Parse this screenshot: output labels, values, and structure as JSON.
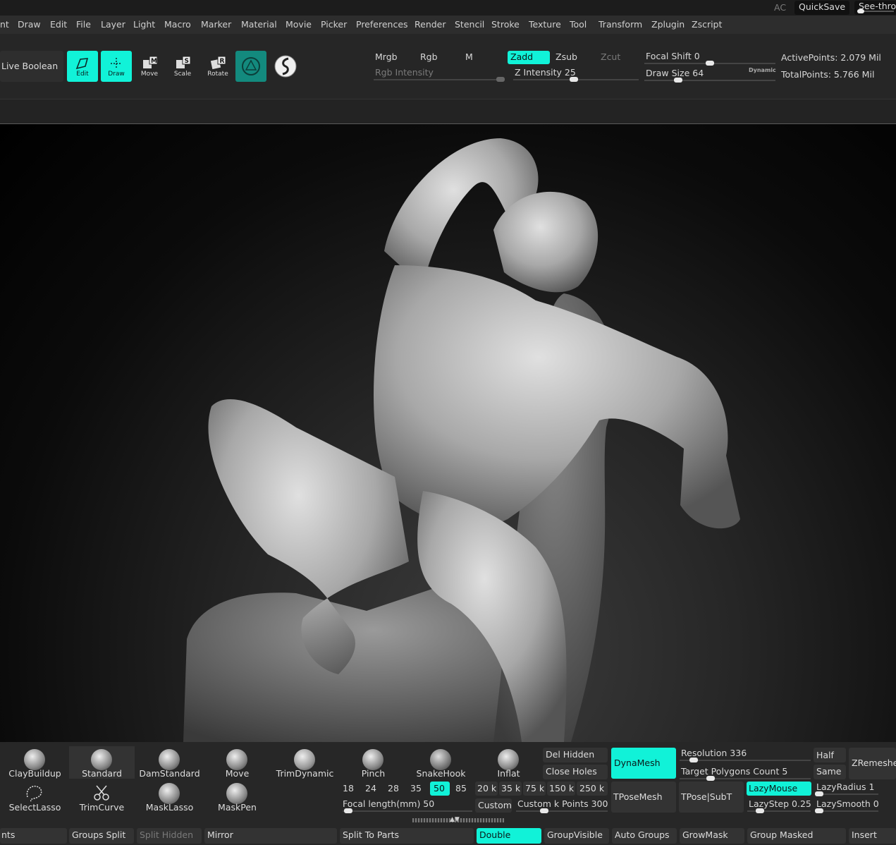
{
  "topbar": {
    "ac": "AC",
    "quicksave": "QuickSave",
    "seethrough": "See-throu"
  },
  "menu": [
    "nt",
    "Draw",
    "Edit",
    "File",
    "Layer",
    "Light",
    "Macro",
    "Marker",
    "Material",
    "Movie",
    "Picker",
    "Preferences",
    "Render",
    "Stencil",
    "Stroke",
    "Texture",
    "Tool",
    "Transform",
    "Zplugin",
    "Zscript"
  ],
  "toolbar": {
    "live_boolean": "Live Boolean",
    "tools": [
      {
        "label": "Edit",
        "active": true
      },
      {
        "label": "Draw",
        "active": true
      },
      {
        "label": "Move",
        "active": false
      },
      {
        "label": "Scale",
        "active": false
      },
      {
        "label": "Rotate",
        "active": false
      }
    ],
    "mrgb": "Mrgb",
    "rgb": "Rgb",
    "m": "M",
    "zadd": "Zadd",
    "zsub": "Zsub",
    "zcut": "Zcut",
    "rgb_intensity": "Rgb Intensity",
    "z_intensity": "Z Intensity 25",
    "z_intensity_value": 25,
    "focal_shift": "Focal Shift 0",
    "focal_shift_value": 0,
    "draw_size": "Draw Size 64",
    "draw_size_value": 64,
    "dynamic": "Dynamic",
    "active_points": "ActivePoints: 2.079 Mil",
    "total_points": "TotalPoints: 5.766 Mil"
  },
  "brushes_row1": [
    "ClayBuildup",
    "Standard",
    "DamStandard",
    "Move",
    "TrimDynamic",
    "Pinch",
    "SnakeHook",
    "Inflat"
  ],
  "brushes_row2": [
    "SelectLasso",
    "TrimCurve",
    "MaskLasso",
    "MaskPen"
  ],
  "focal_numbers": [
    "18",
    "24",
    "28",
    "35",
    "50",
    "85"
  ],
  "focal_length": "Focal length(mm) 50",
  "k_points": [
    "20 k",
    "35 k",
    "75 k",
    "150 k",
    "250 k"
  ],
  "custom": "Custom",
  "custom_k_points": "Custom k Points 300",
  "del_hidden": "Del Hidden",
  "close_holes": "Close Holes",
  "dynamesh": "DynaMesh",
  "resolution": "Resolution 336",
  "resolution_value": 336,
  "target_polygons": "Target Polygons Count 5",
  "target_polygons_value": 5,
  "half": "Half",
  "same": "Same",
  "zremesher": "ZRemesher",
  "tposemesh": "TPoseMesh",
  "tpose_subt": "TPose|SubT",
  "lazymouse": "LazyMouse",
  "lazyradius": "LazyRadius 1",
  "lazyradius_value": 1,
  "lazystep": "LazyStep 0.25",
  "lazystep_value": 0.25,
  "lazysmooth": "LazySmooth 0",
  "lazysmooth_value": 0,
  "bottom_row": [
    "nts",
    "Groups Split",
    "Split Hidden",
    "Mirror",
    "Split To Parts",
    "Double",
    "GroupVisible",
    "Auto Groups",
    "GrowMask",
    "Group Masked",
    "Insert"
  ],
  "colors": {
    "accent": "#11f2d8",
    "panel": "#2d2d2d",
    "viewport": "#000000"
  }
}
